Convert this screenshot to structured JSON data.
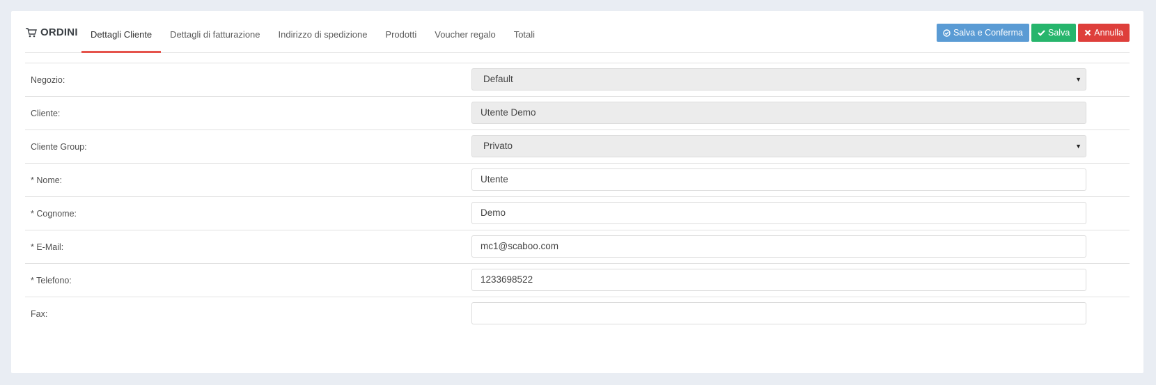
{
  "header": {
    "title": "ORDINI",
    "cart_icon": "cart-icon"
  },
  "tabs": [
    {
      "label": "Dettagli Cliente",
      "active": true
    },
    {
      "label": "Dettagli di fatturazione",
      "active": false
    },
    {
      "label": "Indirizzo di spedizione",
      "active": false
    },
    {
      "label": "Prodotti",
      "active": false
    },
    {
      "label": "Voucher regalo",
      "active": false
    },
    {
      "label": "Totali",
      "active": false
    }
  ],
  "actions": {
    "save_confirm": {
      "label": "Salva e Conferma",
      "icon": "check-circle-icon",
      "color": "#5a9bd4"
    },
    "save": {
      "label": "Salva",
      "icon": "check-icon",
      "color": "#26b56c"
    },
    "cancel": {
      "label": "Annulla",
      "icon": "close-icon",
      "color": "#de3f3b"
    }
  },
  "form": {
    "negozio": {
      "label": "Negozio:",
      "value": "Default"
    },
    "cliente": {
      "label": "Cliente:",
      "value": "Utente Demo"
    },
    "cliente_group": {
      "label": "Cliente Group:",
      "value": "Privato"
    },
    "nome": {
      "label": "* Nome:",
      "value": "Utente"
    },
    "cognome": {
      "label": "* Cognome:",
      "value": "Demo"
    },
    "email": {
      "label": "* E-Mail:",
      "value": "mc1@scaboo.com"
    },
    "telefono": {
      "label": "* Telefono:",
      "value": "1233698522"
    },
    "fax": {
      "label": "Fax:",
      "value": ""
    }
  },
  "colors": {
    "accent_tab_underline": "#e5534b",
    "background": "#e9edf3"
  }
}
